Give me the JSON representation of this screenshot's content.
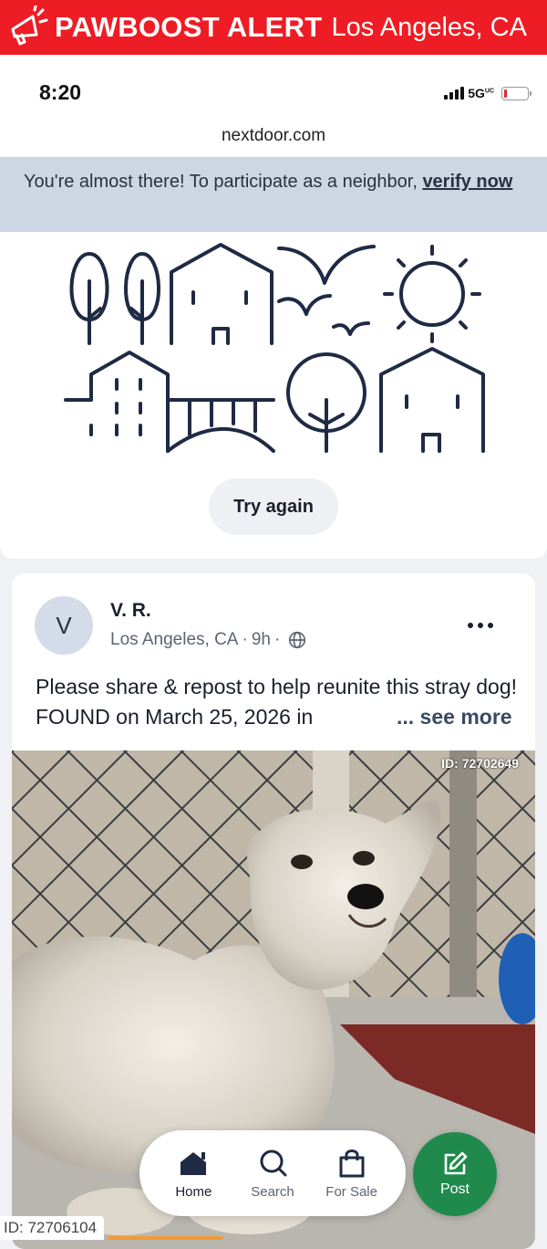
{
  "alert": {
    "brand": "PAWBOOST ALERT",
    "location": "Los Angeles, CA",
    "icon": "megaphone-icon",
    "color": "#ee1c24"
  },
  "status_bar": {
    "time": "8:20",
    "network": "5G",
    "network_suffix": "UC",
    "battery_color": "#e0262b"
  },
  "browser": {
    "url": "nextdoor.com"
  },
  "verify_banner": {
    "text": "You're almost there! To participate as a neighbor, ",
    "link": "verify now"
  },
  "error_state": {
    "retry_label": "Try again"
  },
  "post": {
    "avatar_initial": "V",
    "author": "V. R.",
    "location": "Los Angeles, CA",
    "age": "9h",
    "text": "Please share & repost to help reunite this stray dog! FOUND on March 25, 2026 in",
    "see_more": "... see more",
    "photo_id": "ID: 72702649"
  },
  "bottom_nav": {
    "items": [
      {
        "label": "Home",
        "icon": "home-icon"
      },
      {
        "label": "Search",
        "icon": "search-icon"
      },
      {
        "label": "For Sale",
        "icon": "shopping-bag-icon"
      }
    ],
    "post_label": "Post",
    "post_color": "#1f8a4c"
  },
  "footer": {
    "id": "ID: 72706104"
  }
}
